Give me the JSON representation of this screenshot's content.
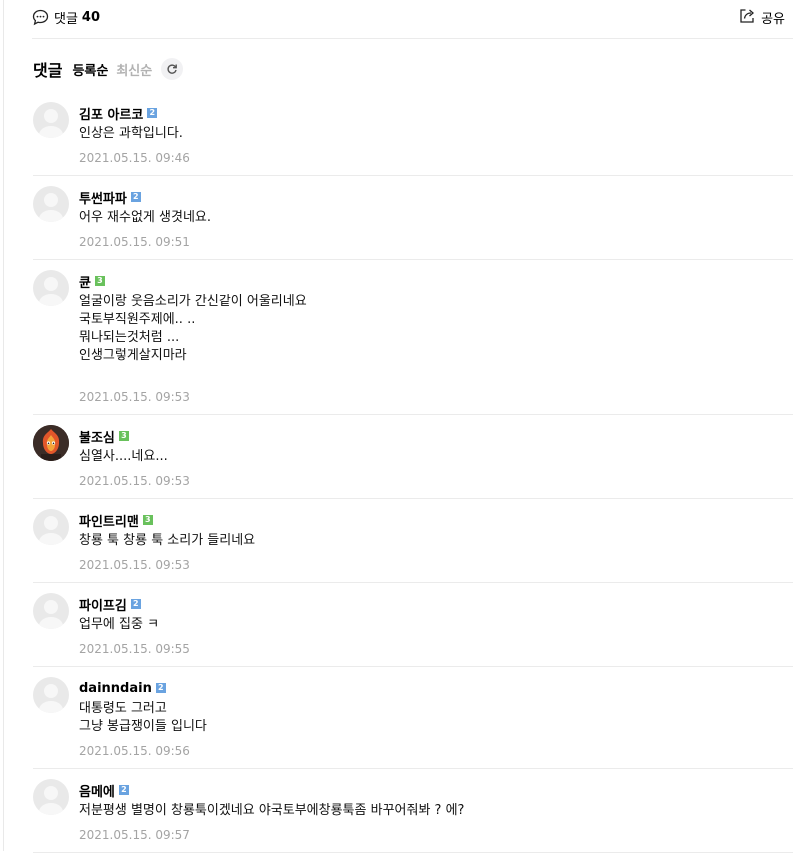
{
  "header": {
    "comment_label": "댓글",
    "comment_count": "40",
    "share_label": "공유"
  },
  "sort": {
    "title": "댓글",
    "options": [
      "등록순",
      "최신순"
    ]
  },
  "comments": [
    {
      "nick": "김포 아르코",
      "level": "2",
      "text": "인상은 과학입니다.",
      "date": "2021.05.15. 09:46"
    },
    {
      "nick": "투썬파파",
      "level": "2",
      "text": "어우 재수없게 생겻네요.",
      "date": "2021.05.15. 09:51"
    },
    {
      "nick": "큔",
      "level": "3",
      "text": "얼굴이랑 웃음소리가 간신같이 어울리네요\n국토부직원주제에.. ..\n뭐나되는것처럼 ...\n인생그렇게살지마라",
      "date": "2021.05.15. 09:53"
    },
    {
      "nick": "불조심",
      "level": "3",
      "text": "심열사....네요...",
      "date": "2021.05.15. 09:53"
    },
    {
      "nick": "파인트리맨",
      "level": "3",
      "text": "창룡 툭 창룡 툭 소리가 들리네요",
      "date": "2021.05.15. 09:53"
    },
    {
      "nick": "파이프김",
      "level": "2",
      "text": "업무에 집중 ㅋ",
      "date": "2021.05.15. 09:55"
    },
    {
      "nick": "dainndain",
      "level": "2",
      "text": "대통령도 그러고\n그냥 봉급쟁이들 입니다",
      "date": "2021.05.15. 09:56"
    },
    {
      "nick": "음메에",
      "level": "2",
      "text": "저분평생 별명이 창룡툭이겠네요 야국토부에창룡툭좀 바꾸어줘봐 ? 에?",
      "date": "2021.05.15. 09:57"
    }
  ]
}
